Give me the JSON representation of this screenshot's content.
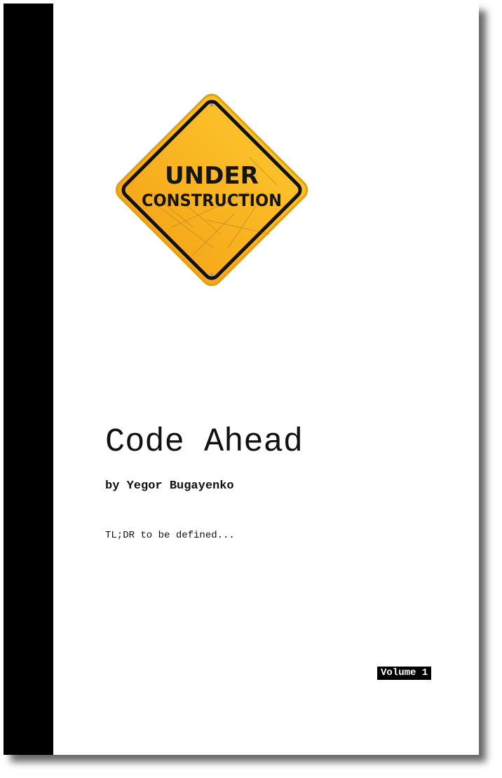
{
  "sign": {
    "line1": "UNDER",
    "line2": "CONSTRUCTION",
    "color": "#f9b21c"
  },
  "book": {
    "title": "Code Ahead",
    "author": "by Yegor Bugayenko",
    "tldr": "TL;DR to be defined...",
    "volume": "Volume 1"
  }
}
